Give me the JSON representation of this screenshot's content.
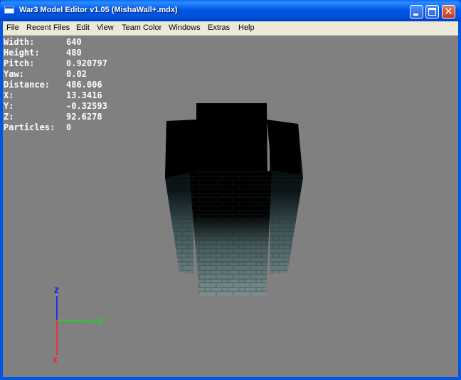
{
  "window": {
    "title": "War3 Model Editor v1.05 (MishaWall+.mdx)",
    "icon": "app-window-icon"
  },
  "controls": {
    "minimize_icon": "minimize-icon",
    "maximize_icon": "maximize-icon",
    "close_glyph": "✕"
  },
  "menu": [
    {
      "label": "File"
    },
    {
      "label": "Recent Files"
    },
    {
      "label": "Edit"
    },
    {
      "label": "View"
    },
    {
      "label": "Team Color"
    },
    {
      "label": "Windows"
    },
    {
      "label": "Extras"
    },
    {
      "label": "Help"
    }
  ],
  "viewport_info": [
    {
      "label": "Width:",
      "value": "640"
    },
    {
      "label": "Height:",
      "value": "480"
    },
    {
      "label": "Pitch:",
      "value": "0.920797"
    },
    {
      "label": "Yaw:",
      "value": "0.02"
    },
    {
      "label": "Distance:",
      "value": "486.006"
    },
    {
      "label": "X:",
      "value": "13.3416"
    },
    {
      "label": "Y:",
      "value": "-0.32593"
    },
    {
      "label": "Z:",
      "value": "92.6278"
    },
    {
      "label": "Particles:",
      "value": "0"
    }
  ],
  "axes": {
    "z_label": "Z",
    "y_label": "Y",
    "x_label": "X",
    "z_color": "#1010ff",
    "y_color": "#10e010",
    "x_color": "#ff2020"
  },
  "viewport_background": "#808080"
}
